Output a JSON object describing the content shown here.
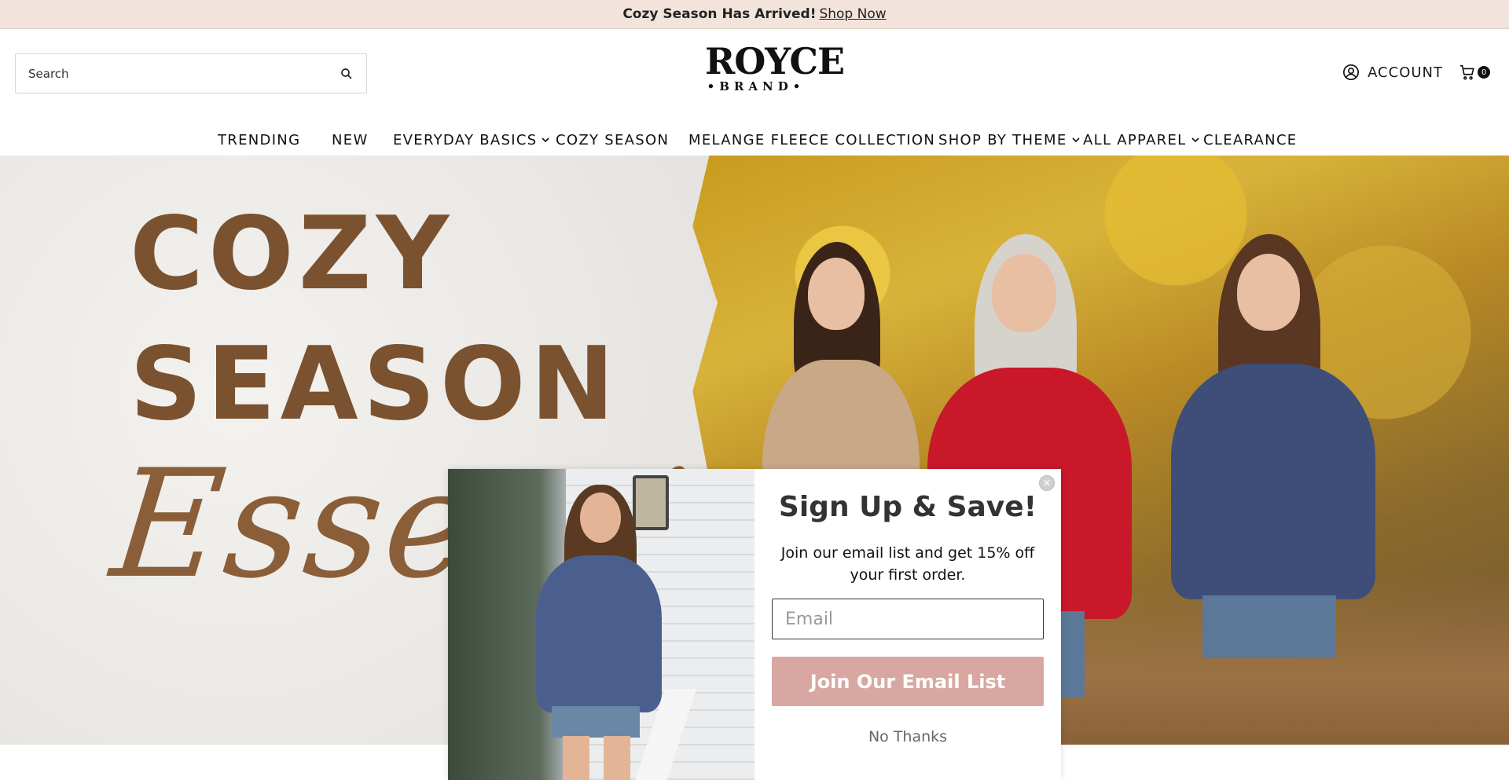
{
  "announcement": {
    "bold": "Cozy Season Has Arrived!",
    "link": "Shop Now"
  },
  "search": {
    "placeholder": "Search"
  },
  "logo": {
    "line1": "ROYCE",
    "line2": "•BRAND•"
  },
  "account": {
    "label": "ACCOUNT"
  },
  "cart": {
    "count": "0"
  },
  "nav": [
    {
      "label": "TRENDING",
      "has_dropdown": false
    },
    {
      "label": "NEW",
      "has_dropdown": false
    },
    {
      "label": "EVERYDAY BASICS",
      "has_dropdown": true
    },
    {
      "label": "COZY SEASON",
      "has_dropdown": false
    },
    {
      "label": "MELANGE FLEECE COLLECTION",
      "has_dropdown": false
    },
    {
      "label": "SHOP BY THEME",
      "has_dropdown": true
    },
    {
      "label": "ALL APPAREL",
      "has_dropdown": true
    },
    {
      "label": "CLEARANCE",
      "has_dropdown": false
    }
  ],
  "hero": {
    "line1": "COZY",
    "line2": "SEASON",
    "script": "Essentia"
  },
  "modal": {
    "title": "Sign Up & Save!",
    "text": "Join our email list and get 15% off your first order.",
    "email_placeholder": "Email",
    "join_label": "Join Our Email List",
    "no_thanks": "No Thanks",
    "close_glyph": "✕"
  },
  "colors": {
    "announcement_bg": "#f2e4dc",
    "hero_brown": "#7a5230",
    "join_button": "#d9a7a2"
  }
}
